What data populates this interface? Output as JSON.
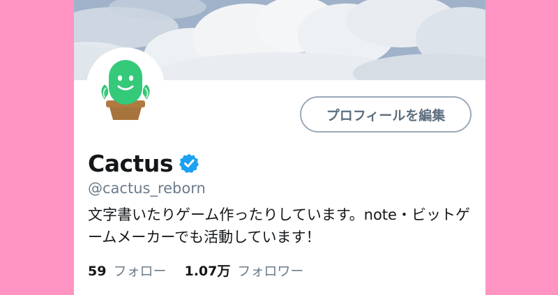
{
  "profile": {
    "display_name": "Cactus",
    "handle": "@cactus_reborn",
    "bio": "文字書いたりゲーム作ったりしています。note・ビットゲームメーカーでも活動しています！",
    "edit_profile_label": "プロフィールを編集"
  },
  "stats": {
    "following_count": "59",
    "following_label": "フォロー",
    "followers_count": "1.07万",
    "followers_label": "フォロワー"
  },
  "icons": {
    "verified": "verified-badge-icon",
    "avatar": "cactus-avatar"
  },
  "colors": {
    "page_background": "#ff94c3",
    "card_background": "#ffffff",
    "verified_blue": "#1da1f2",
    "avatar_green": "#35c97a",
    "pot_brown": "#a8743d",
    "button_border": "#9aa9b7",
    "secondary_text": "#6b7b8b"
  }
}
